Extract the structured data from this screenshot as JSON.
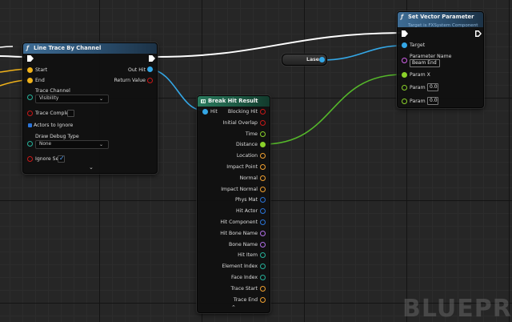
{
  "line_trace": {
    "title": "Line Trace By Channel",
    "inputs": {
      "start": "Start",
      "end": "End",
      "trace_channel": "Trace Channel",
      "trace_channel_value": "Visibility",
      "trace_complex": "Trace Complex",
      "actors_to_ignore": "Actors to Ignore",
      "draw_debug_type": "Draw Debug Type",
      "draw_debug_value": "None",
      "ignore_self": "Ignore Self"
    },
    "outputs": {
      "out_hit": "Out Hit",
      "return_value": "Return Value"
    },
    "trace_complex_checked": false,
    "ignore_self_checked": true
  },
  "break_hit": {
    "title": "Break Hit Result",
    "input": "Hit",
    "outputs": [
      "Blocking Hit",
      "Initial Overlap",
      "Time",
      "Distance",
      "Location",
      "Impact Point",
      "Normal",
      "Impact Normal",
      "Phys Mat",
      "Hit Actor",
      "Hit Component",
      "Hit Bone Name",
      "Bone Name",
      "Hit Item",
      "Element Index",
      "Face Index",
      "Trace Start",
      "Trace End"
    ]
  },
  "laser_var": {
    "label": "Laser"
  },
  "set_vector": {
    "title": "Set Vector Parameter",
    "subtitle": "Target is FXSystem Component",
    "target": "Target",
    "parameter_name": "Parameter Name",
    "parameter_name_value": "Beam End",
    "param_x": "Param X",
    "param_y": "Param Y",
    "param_y_value": "0.0",
    "param_z": "Param Z",
    "param_z_value": "0.0"
  },
  "watermark": "BLUEPR",
  "colors": {
    "exec": "#ffffff",
    "struct": "#34a7e6",
    "bool": "#c81818",
    "float": "#8ad02a",
    "vector": "#f0b21a",
    "name": "#b06ee6",
    "object": "#2b74d8"
  }
}
